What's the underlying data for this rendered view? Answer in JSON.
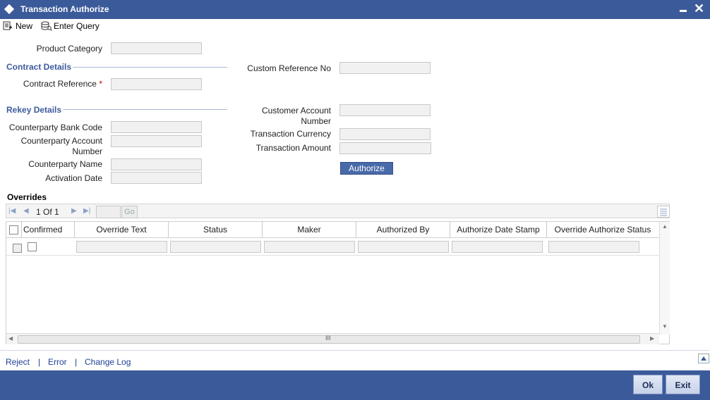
{
  "window": {
    "title": "Transaction Authorize"
  },
  "toolbar": {
    "new_label": "New",
    "enter_query_label": "Enter Query"
  },
  "form": {
    "product_category": {
      "label": "Product Category",
      "value": ""
    },
    "contract_details": {
      "heading": "Contract Details"
    },
    "contract_reference": {
      "label": "Contract Reference",
      "required": "*",
      "value": ""
    },
    "custom_reference_no": {
      "label": "Custom Reference No",
      "value": ""
    },
    "rekey_details": {
      "heading": "Rekey Details"
    },
    "counterparty_bank_code": {
      "label": "Counterparty Bank Code",
      "value": ""
    },
    "counterparty_account_number": {
      "label_line1": "Counterparty Account",
      "label_line2": "Number",
      "value": ""
    },
    "counterparty_name": {
      "label": "Counterparty Name",
      "value": ""
    },
    "activation_date": {
      "label": "Activation Date",
      "value": ""
    },
    "customer_account_number": {
      "label_line1": "Customer Account",
      "label_line2": "Number",
      "value": ""
    },
    "transaction_currency": {
      "label": "Transaction Currency",
      "value": ""
    },
    "transaction_amount": {
      "label": "Transaction Amount",
      "value": ""
    },
    "authorize_button": "Authorize"
  },
  "overrides": {
    "title": "Overrides",
    "pager": {
      "page": "1",
      "of_label": "Of",
      "total": "1",
      "go_label": "Go"
    },
    "columns": [
      "Confirmed",
      "Override Text",
      "Status",
      "Maker",
      "Authorized By",
      "Authorize Date Stamp",
      "Override Authorize Status"
    ],
    "scroll_marker": "III"
  },
  "links": {
    "reject": "Reject",
    "error": "Error",
    "change_log": "Change Log",
    "separator": "|"
  },
  "footer": {
    "ok_label": "Ok",
    "exit_label": "Exit"
  },
  "colors": {
    "titlebar": "#3b5a9a",
    "section_heading": "#3c5a9e",
    "link": "#1d3f96",
    "required": "#cc0000"
  }
}
